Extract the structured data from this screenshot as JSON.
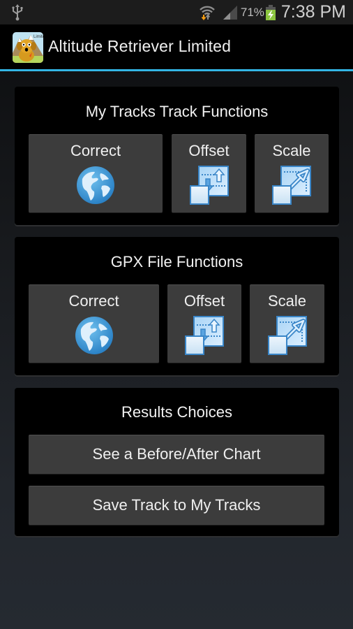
{
  "status_bar": {
    "usb_icon": "usb-icon",
    "wifi_icon": "wifi-data-activity-icon",
    "signal_icon": "cell-signal-icon",
    "battery_percent": "71%",
    "battery_icon": "battery-charging-icon",
    "time": "7:38 PM"
  },
  "action_bar": {
    "app_icon": "altitude-retriever-dog-logo",
    "title": "Altitude Retriever Limited",
    "accent_color": "#33b5e5"
  },
  "sections": [
    {
      "title": "My Tracks Track Functions",
      "buttons": [
        {
          "label": "Correct",
          "icon": "globe-icon"
        },
        {
          "label": "Offset",
          "icon": "offset-icon"
        },
        {
          "label": "Scale",
          "icon": "scale-icon"
        }
      ]
    },
    {
      "title": "GPX File Functions",
      "buttons": [
        {
          "label": "Correct",
          "icon": "globe-icon"
        },
        {
          "label": "Offset",
          "icon": "offset-icon"
        },
        {
          "label": "Scale",
          "icon": "scale-icon"
        }
      ]
    },
    {
      "title": "Results Choices",
      "buttons": [
        {
          "label": "See a Before/After Chart"
        },
        {
          "label": "Save Track to My Tracks"
        }
      ]
    }
  ]
}
